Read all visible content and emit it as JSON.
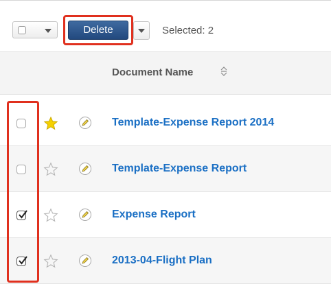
{
  "toolbar": {
    "delete_label": "Delete",
    "selected_text": "Selected: 2"
  },
  "table": {
    "column_header": "Document Name",
    "rows": [
      {
        "name": "Template-Expense Report 2014",
        "checked": false,
        "favorite": true
      },
      {
        "name": "Template-Expense Report",
        "checked": false,
        "favorite": false
      },
      {
        "name": "Expense Report",
        "checked": true,
        "favorite": false
      },
      {
        "name": "2013-04-Flight Plan",
        "checked": true,
        "favorite": false
      }
    ]
  },
  "colors": {
    "highlight": "#e0301e",
    "delete_button": "#2b5288",
    "link": "#1a6fc4",
    "favorite_star": "#f5d000"
  },
  "icons": {
    "sort": "sort-icon",
    "star": "star-icon",
    "edit": "pencil-icon"
  }
}
